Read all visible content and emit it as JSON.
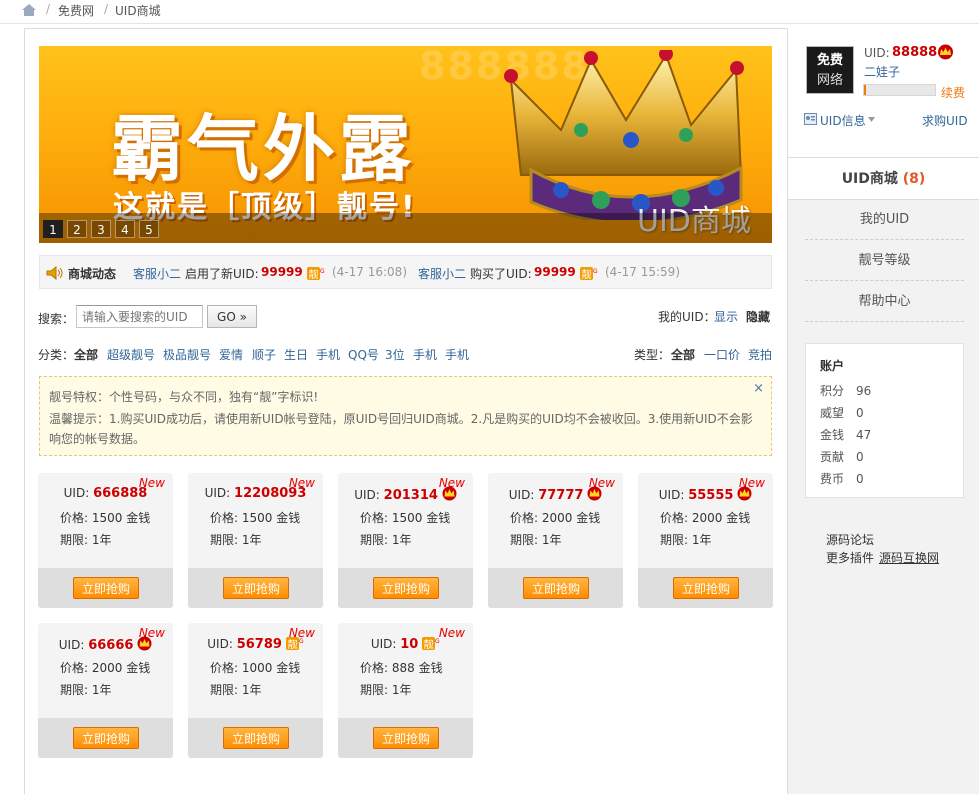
{
  "breadcrumb": {
    "items": [
      "免费网",
      "UID商城"
    ]
  },
  "banner": {
    "title": "霸气外露",
    "subtitle": "这就是［顶级］靓号!",
    "watermark_text": "888888",
    "brand_mark": "UID商城",
    "slides": [
      "1",
      "2",
      "3",
      "4",
      "5"
    ],
    "active_slide": "1"
  },
  "news": {
    "label": "商城动态",
    "entries": [
      {
        "user": "客服小二",
        "action": "启用了新UID:",
        "uid": "99999",
        "time": "(4-17 16:08)"
      },
      {
        "user": "客服小二",
        "action": "购买了UID:",
        "uid": "99999",
        "time": "(4-17 15:59)"
      }
    ]
  },
  "search": {
    "label": "搜索：",
    "placeholder": "请输入要搜索的UID",
    "button": "GO »",
    "my_uid_label": "我的UID：",
    "show": "显示",
    "hide": "隐藏"
  },
  "filters": {
    "category_label": "分类：",
    "categories": [
      "全部",
      "超级靓号",
      "极品靓号",
      "爱情",
      "顺子",
      "生日",
      "手机",
      "QQ号",
      "3位",
      "手机",
      "手机"
    ],
    "type_label": "类型：",
    "types": [
      "全部",
      "一口价",
      "竞拍"
    ]
  },
  "notice": {
    "line1": "靓号特权：个性号码，与众不同，独有“靓”字标识!",
    "line2": "温馨提示：1.购买UID成功后，请使用新UID帐号登陆，原UID号回归UID商城。2.凡是购买的UID均不会被收回。3.使用新UID不会影响您的帐号数据。",
    "close": "×"
  },
  "labels": {
    "uid": "UID:",
    "price": "价格:",
    "term": "期限:",
    "currency": "金钱",
    "buy": "立即抢购",
    "new": "New"
  },
  "items": [
    {
      "uid": "666888",
      "price": "1500",
      "term": "1年",
      "badge": "none"
    },
    {
      "uid": "12208093",
      "price": "1500",
      "term": "1年",
      "badge": "none"
    },
    {
      "uid": "201314",
      "price": "1500",
      "term": "1年",
      "badge": "crown"
    },
    {
      "uid": "77777",
      "price": "2000",
      "term": "1年",
      "badge": "crown"
    },
    {
      "uid": "55555",
      "price": "2000",
      "term": "1年",
      "badge": "crown"
    },
    {
      "uid": "66666",
      "price": "2000",
      "term": "1年",
      "badge": "crown"
    },
    {
      "uid": "56789",
      "price": "1000",
      "term": "1年",
      "badge": "xin"
    },
    {
      "uid": "10",
      "price": "888",
      "term": "1年",
      "badge": "xin"
    }
  ],
  "sidebar": {
    "avatar_line1": "免费",
    "avatar_line2": "网络",
    "uid_label": "UID:",
    "uid_value": "88888",
    "username": "二娃子",
    "renew": "续费",
    "uid_info": "UID信息",
    "wanted": "求购UID",
    "active_nav": "UID商城",
    "active_count": "(8)",
    "nav": [
      "我的UID",
      "靓号等级",
      "帮助中心"
    ],
    "account_title": "账户",
    "account": [
      {
        "label": "积分",
        "value": "96"
      },
      {
        "label": "威望",
        "value": "0"
      },
      {
        "label": "金钱",
        "value": "47"
      },
      {
        "label": "贡献",
        "value": "0"
      },
      {
        "label": "费币",
        "value": "0"
      }
    ],
    "forum": "源码论坛",
    "more_plugins": "更多插件",
    "more_link": "源码互换网"
  },
  "colors": {
    "accent": "#f08a00",
    "uid_red": "#cc0000",
    "link": "#336699",
    "new_red": "#e60000"
  }
}
